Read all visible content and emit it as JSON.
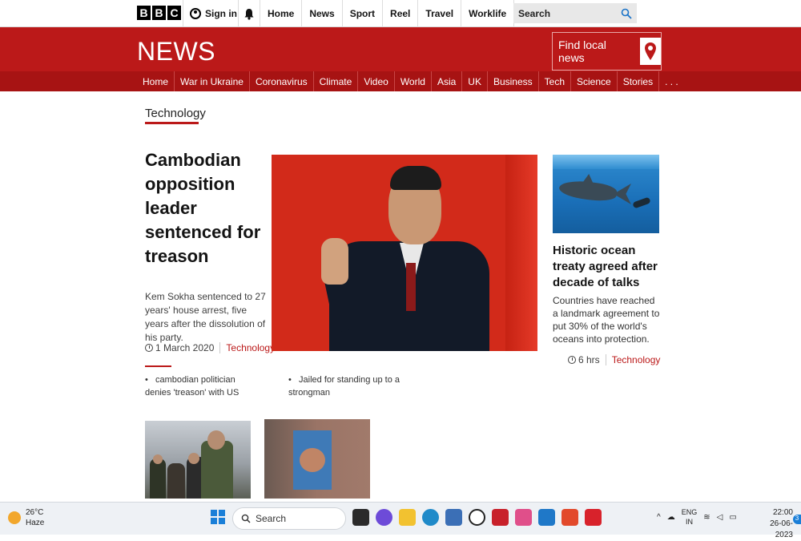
{
  "header": {
    "logo_letters": [
      "B",
      "B",
      "C"
    ],
    "signin_label": "Sign in",
    "nav": [
      "Home",
      "News",
      "Sport",
      "Reel",
      "Travel",
      "Worklife",
      ". . ."
    ],
    "search_placeholder": "Search"
  },
  "newsband": {
    "title": "NEWS",
    "find_local": "Find local news"
  },
  "subnav": {
    "items": [
      "Home",
      "War in Ukraine",
      "Coronavirus",
      "Climate",
      "Video",
      "World",
      "Asia",
      "UK",
      "Business",
      "Tech",
      "Science",
      "Stories",
      ". . ."
    ]
  },
  "section": {
    "title": "Technology"
  },
  "lead": {
    "headline": "Cambodian opposition leader sentenced for treason",
    "summary": "Kem Sokha sentenced to 27 years' house arrest, five years after the dissolution of his party.",
    "date": "1 March 2020",
    "category": "Technology",
    "related": [
      "cambodian politician denies 'treason' with US",
      "Jailed for standing up to a strongman"
    ]
  },
  "side_story": {
    "headline": "Historic ocean treaty agreed after decade of talks",
    "summary": "Countries have reached a landmark agreement to put 30% of the world's oceans into protection.",
    "time": "6 hrs",
    "category": "Technology"
  },
  "colors": {
    "brand_red": "#bb1919",
    "subnav_red": "#a71313",
    "taskbar_bg": "#eef1f5"
  },
  "taskbar": {
    "weather_temp": "26°C",
    "weather_desc": "Haze",
    "search_label": "Search",
    "lang_top": "ENG",
    "lang_bottom": "IN",
    "time": "22:00",
    "date": "26-06-2023",
    "notification_count": "3"
  }
}
